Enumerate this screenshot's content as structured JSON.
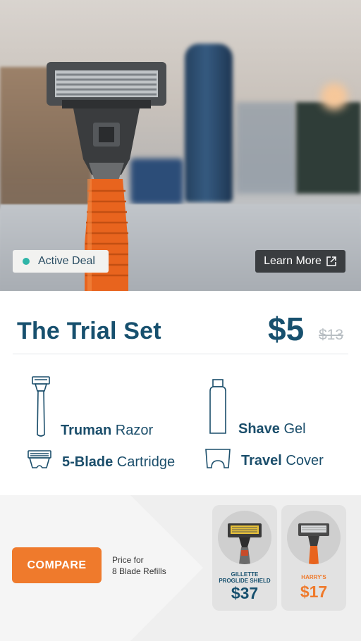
{
  "hero": {
    "active_badge": "Active Deal",
    "learn_more": "Learn More"
  },
  "product": {
    "title": "The Trial Set",
    "price": "$5",
    "old_price": "$13"
  },
  "items": [
    {
      "bold": "Truman",
      "rest": " Razor",
      "icon": "razor-icon"
    },
    {
      "bold": "Shave",
      "rest": " Gel",
      "icon": "gel-bottle-icon"
    },
    {
      "bold": "5-Blade",
      "rest": " Cartridge",
      "icon": "cartridge-icon"
    },
    {
      "bold": "Travel",
      "rest": " Cover",
      "icon": "travel-cover-icon"
    }
  ],
  "compare": {
    "button": "COMPARE",
    "price_for_line1": "Price for",
    "price_for_line2": "8 Blade Refills",
    "competitors": [
      {
        "brand_line1": "GILLETTE",
        "brand_line2": "PROGLIDE SHIELD",
        "price": "$37",
        "color": "#17506e"
      },
      {
        "brand_line1": "HARRY'S",
        "brand_line2": "",
        "price": "$17",
        "color": "#ef7a2c"
      }
    ]
  },
  "colors": {
    "navy": "#17506e",
    "orange": "#ef7a2c",
    "teal": "#2fb5a8"
  }
}
